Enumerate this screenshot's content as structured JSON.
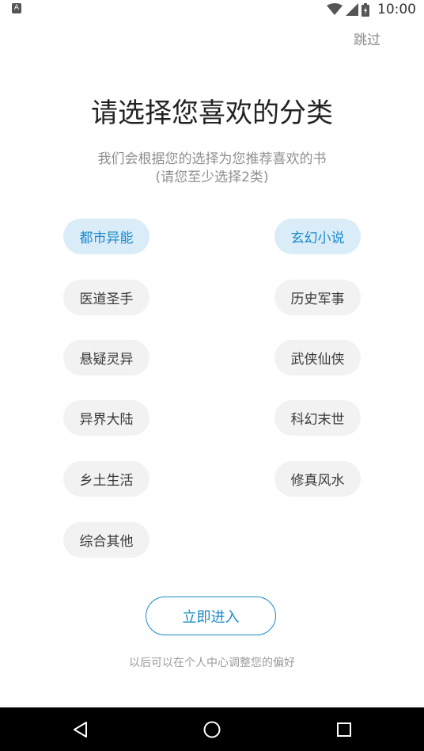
{
  "status_bar": {
    "time": "10:00",
    "app_icon_glyph": "A"
  },
  "header": {
    "skip_label": "跳过"
  },
  "main": {
    "title": "请选择您喜欢的分类",
    "subtitle_line1": "我们会根据您的选择为您推荐喜欢的书",
    "subtitle_line2": "(请您至少选择2类)",
    "categories": [
      {
        "label": "都市异能",
        "selected": true
      },
      {
        "label": "玄幻小说",
        "selected": true
      },
      {
        "label": "医道圣手",
        "selected": false
      },
      {
        "label": "历史军事",
        "selected": false
      },
      {
        "label": "悬疑灵异",
        "selected": false
      },
      {
        "label": "武侠仙侠",
        "selected": false
      },
      {
        "label": "异界大陆",
        "selected": false
      },
      {
        "label": "科幻末世",
        "selected": false
      },
      {
        "label": "乡土生活",
        "selected": false
      },
      {
        "label": "修真风水",
        "selected": false
      },
      {
        "label": "综合其他",
        "selected": false
      }
    ],
    "enter_label": "立即进入",
    "hint": "以后可以在个人中心调整您的偏好"
  },
  "colors": {
    "accent": "#1a8ac9",
    "selected_bg": "#daecf8",
    "chip_bg": "#f2f2f2"
  },
  "icons": {
    "back": "back-icon",
    "home": "home-icon",
    "recents": "recents-icon"
  }
}
